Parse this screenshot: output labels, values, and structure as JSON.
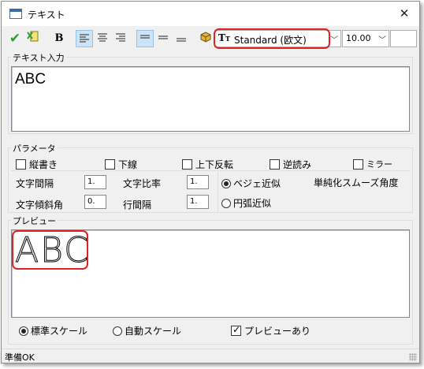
{
  "window": {
    "title": "テキスト"
  },
  "toolbar": {
    "font_name": "Standard (欧文)",
    "font_size": "10.00",
    "accent_color": "#2e9c2e",
    "highlight_color": "#e02222"
  },
  "text_input": {
    "group_label": "テキスト入力",
    "value": "ABC"
  },
  "parameters": {
    "group_label": "パラメータ",
    "checkboxes": [
      {
        "label": "縦書き",
        "checked": false
      },
      {
        "label": "下線",
        "checked": false
      },
      {
        "label": "上下反転",
        "checked": false
      },
      {
        "label": "逆読み",
        "checked": false
      },
      {
        "label": "ミラー",
        "checked": false
      }
    ],
    "char_spacing_label": "文字間隔",
    "char_spacing_value": "1.",
    "char_ratio_label": "文字比率",
    "char_ratio_value": "1.",
    "char_slant_label": "文字傾斜角",
    "char_slant_value": "0.",
    "line_spacing_label": "行間隔",
    "line_spacing_value": "1.",
    "curve_options": [
      {
        "label": "ベジェ近似",
        "selected": true
      },
      {
        "label": "円弧近似",
        "selected": false
      }
    ],
    "simplify_label": "単純化スムーズ角度"
  },
  "preview": {
    "group_label": "プレビュー",
    "sample_text": "ABC",
    "scale_options": [
      {
        "label": "標準スケール",
        "selected": true
      },
      {
        "label": "自動スケール",
        "selected": false
      }
    ],
    "show_preview_label": "プレビューあり",
    "show_preview_checked": true
  },
  "status": {
    "text": "準備OK"
  }
}
